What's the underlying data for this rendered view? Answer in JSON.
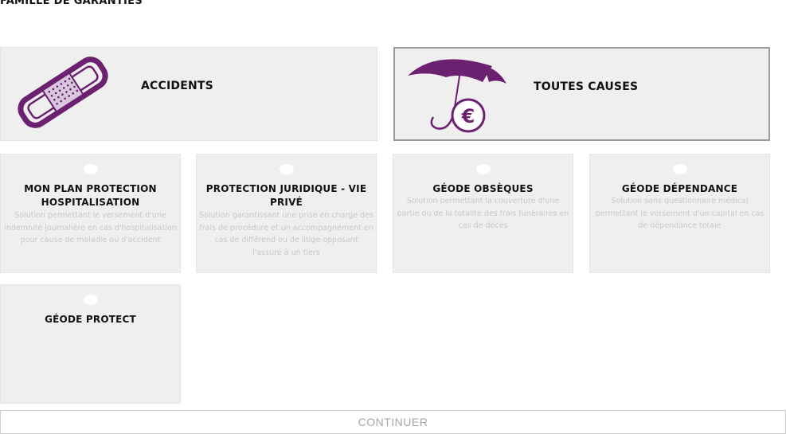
{
  "section_title": "FAMILLE DE GARANTIES",
  "colors": {
    "accent": "#6b2170",
    "card_bg": "#efefef",
    "muted_text": "#c9c9c9"
  },
  "families": [
    {
      "label": "ACCIDENTS",
      "icon": "bandage-icon",
      "selected": false
    },
    {
      "label": "TOUTES CAUSES",
      "icon": "umbrella-euro-icon",
      "selected": true
    }
  ],
  "products": [
    {
      "title": "MON PLAN PROTECTION HOSPITALISATION",
      "description": "Solution permettant le versement d'une indemnité journalière en cas d'hospitalisation pour cause de maladie ou d'accident"
    },
    {
      "title": "PROTECTION JURIDIQUE - VIE PRIVÉ",
      "description": "Solution garantissant une prise en charge des frais de procédure et un accompagnement en cas de différend ou de litige opposant l'assuré à un tiers"
    },
    {
      "title": "GÉODE OBSÈQUES",
      "description": "Solution permettant la couverture d'une partie ou de la totalité des frais funéraires en cas de décès"
    },
    {
      "title": "GÉODE DÉPENDANCE",
      "description": "Solution sans questionnaire médical permettant le versement d'un capital en cas de dépendance totale"
    },
    {
      "title": "GÉODE PROTECT",
      "description": ""
    }
  ],
  "continue_label": "CONTINUER"
}
